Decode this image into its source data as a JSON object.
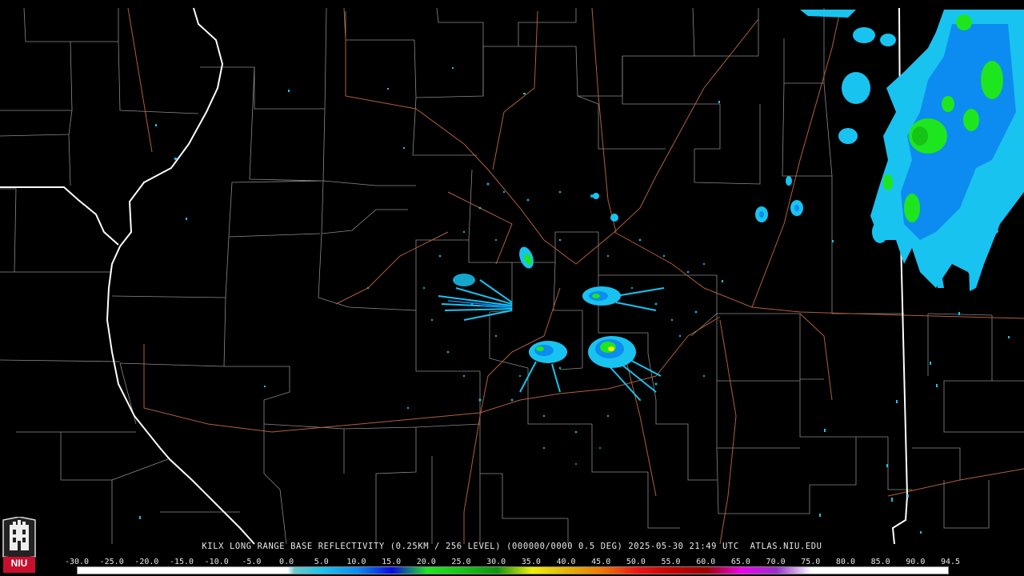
{
  "caption": "KILX LONG RANGE BASE REFLECTIVITY (0.25KM / 256 LEVEL) (000000/0000 0.5 DEG) 2025-05-30 21:49 UTC  ATLAS.NIU.EDU",
  "scale": {
    "labels": [
      "-30.0",
      "-25.0",
      "-20.0",
      "-15.0",
      "-10.0",
      "-5.0",
      "0.0",
      "5.0",
      "10.0",
      "15.0",
      "20.0",
      "25.0",
      "30.0",
      "35.0",
      "40.0",
      "45.0",
      "50.0",
      "55.0",
      "60.0",
      "65.0",
      "70.0",
      "75.0",
      "80.0",
      "85.0",
      "90.0",
      "94.5"
    ],
    "gradient_stops": [
      {
        "dbz": -30,
        "color": "#ffffff"
      },
      {
        "dbz": 0,
        "color": "#ffffff"
      },
      {
        "dbz": 1,
        "color": "#6ac8c8"
      },
      {
        "dbz": 5,
        "color": "#19c3f0"
      },
      {
        "dbz": 10,
        "color": "#0c8cf0"
      },
      {
        "dbz": 15,
        "color": "#0a0ae6"
      },
      {
        "dbz": 20,
        "color": "#1ee61e"
      },
      {
        "dbz": 25,
        "color": "#16c416"
      },
      {
        "dbz": 30,
        "color": "#0e940e"
      },
      {
        "dbz": 35,
        "color": "#f0f000"
      },
      {
        "dbz": 40,
        "color": "#e6b400"
      },
      {
        "dbz": 45,
        "color": "#f07800"
      },
      {
        "dbz": 50,
        "color": "#f01414"
      },
      {
        "dbz": 55,
        "color": "#c80000"
      },
      {
        "dbz": 60,
        "color": "#a00000"
      },
      {
        "dbz": 65,
        "color": "#f000f0"
      },
      {
        "dbz": 70,
        "color": "#9632c8"
      },
      {
        "dbz": 75,
        "color": "#ffffff"
      },
      {
        "dbz": 94.5,
        "color": "#ffffff"
      }
    ]
  },
  "logo": {
    "text": "NIU",
    "color": "#c8102e"
  },
  "colors": {
    "state_border": "#ffffff",
    "county_border": "#8a8a8a",
    "highway": "#b0603a",
    "echo_light": "#19c3f0",
    "echo_mid": "#0c8cf0",
    "echo_green": "#1ee61e",
    "echo_yellow": "#f0f000"
  }
}
